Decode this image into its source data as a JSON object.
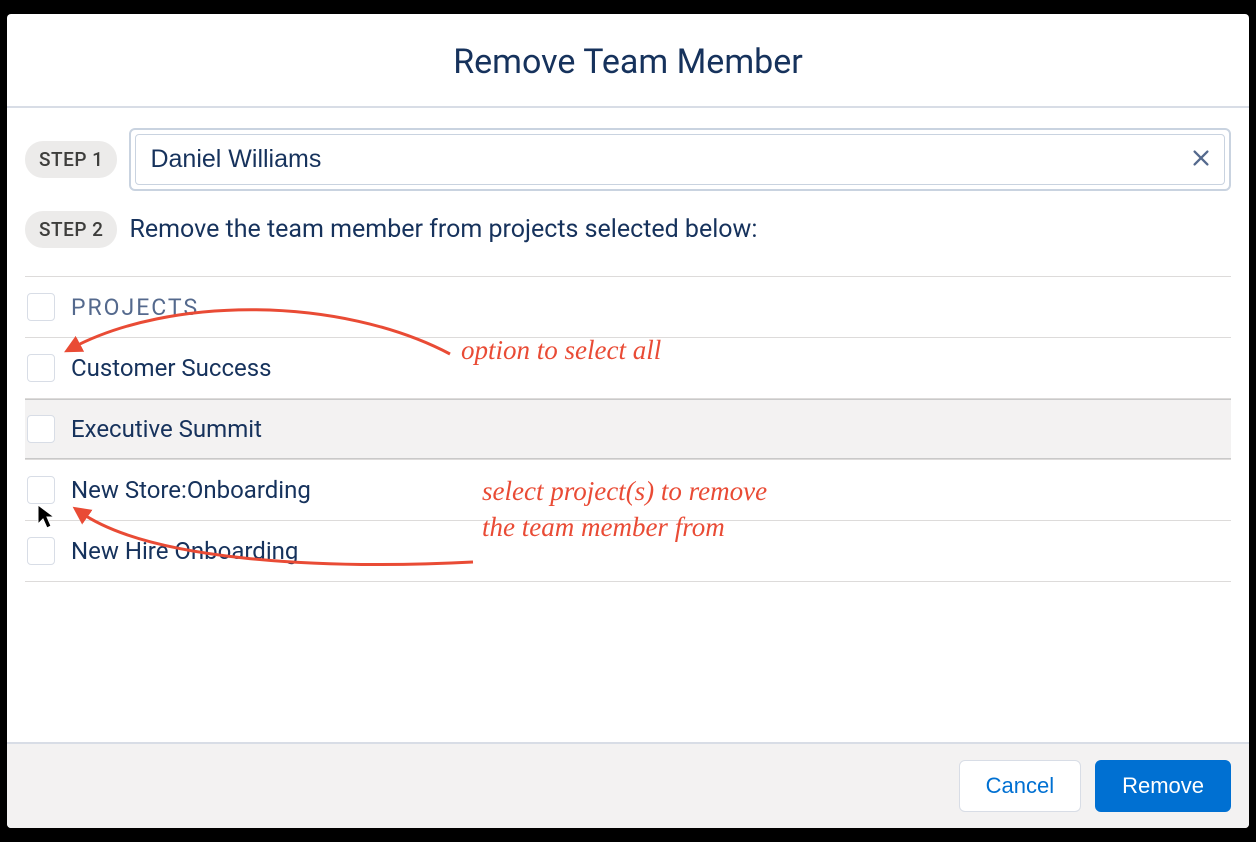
{
  "colors": {
    "accent": "#0070d2",
    "text_dark": "#16325c",
    "annotation": "#e94b35"
  },
  "modal": {
    "title": "Remove Team Member"
  },
  "step1": {
    "badge": "STEP 1",
    "name_value": "Daniel Williams"
  },
  "step2": {
    "badge": "STEP 2",
    "instruction": "Remove the team member from projects selected below:"
  },
  "projects": {
    "header_label": "PROJECTS",
    "items": [
      {
        "label": "Customer Success",
        "checked": false,
        "hover": false
      },
      {
        "label": "Executive Summit",
        "checked": false,
        "hover": true
      },
      {
        "label": "New Store:Onboarding",
        "checked": false,
        "hover": false
      },
      {
        "label": "New Hire Onboarding",
        "checked": false,
        "hover": false
      }
    ]
  },
  "footer": {
    "cancel_label": "Cancel",
    "remove_label": "Remove"
  },
  "annotations": {
    "select_all": "option to select all",
    "select_projects_line1": "select project(s) to remove",
    "select_projects_line2": "the team member from"
  }
}
